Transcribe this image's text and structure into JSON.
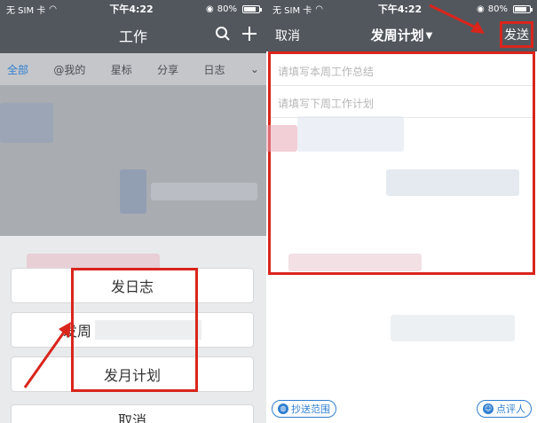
{
  "left": {
    "status": {
      "carrier": "无 SIM 卡",
      "time": "下午4:22",
      "battery": "80%"
    },
    "nav": {
      "title": "工作",
      "icons": [
        "search-icon",
        "plus-icon"
      ]
    },
    "tabs": [
      "全部",
      "@我的",
      "星标",
      "分享",
      "日志"
    ],
    "sheet": {
      "day": "发日志",
      "week": "发周",
      "month": "发月计划",
      "cancel": "取消"
    }
  },
  "right": {
    "status": {
      "carrier": "无 SIM 卡",
      "time": "下午4:22",
      "battery": "80%"
    },
    "nav": {
      "cancel": "取消",
      "title": "发周计划",
      "send": "发送"
    },
    "placeholders": {
      "summary": "请填写本周工作总结",
      "plan": "请填写下周工作计划"
    },
    "bottom": {
      "cc": "抄送范围",
      "reviewer": "点评人"
    }
  },
  "colors": {
    "accent": "#2f7fd1",
    "highlight": "#d9251c",
    "navbar": "#52575e"
  }
}
